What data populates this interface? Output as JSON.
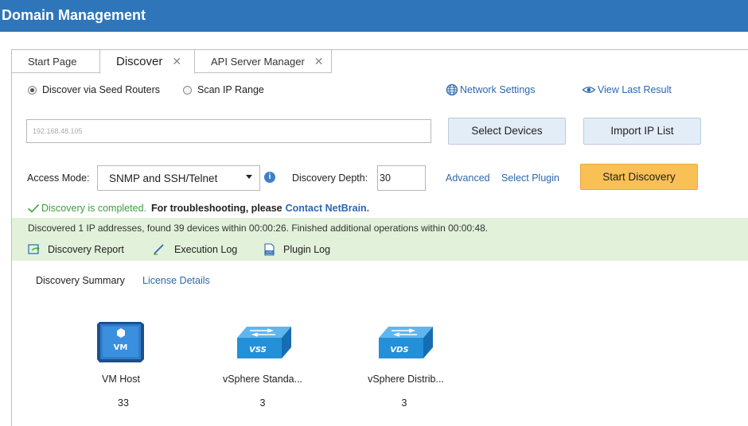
{
  "window": {
    "title": "Domain Management"
  },
  "tabs": [
    {
      "label": "Start Page"
    },
    {
      "label": "Discover"
    },
    {
      "label": "API Server Manager"
    }
  ],
  "discover": {
    "radio_seed_label": "Discover via Seed Routers",
    "radio_scan_label": "Scan IP Range",
    "network_settings_label": "Network Settings",
    "view_last_result_label": "View Last Result",
    "seed_ip_value": "192.168.48.105",
    "select_devices_label": "Select Devices",
    "import_ip_list_label": "Import IP List",
    "access_mode_label": "Access Mode:",
    "access_mode_value": "SNMP and SSH/Telnet",
    "discovery_depth_label": "Discovery Depth:",
    "discovery_depth_value": "30",
    "advanced_label": "Advanced",
    "select_plugin_label": "Select Plugin",
    "start_discovery_label": "Start Discovery"
  },
  "status": {
    "completed_text": "Discovery is completed.",
    "troubleshoot_text": "For troubleshooting, please",
    "contact_link": "Contact NetBrain.",
    "summary_line": "Discovered 1 IP addresses, found 39 devices within 00:00:26.  Finished additional operations within 00:00:48.",
    "discovery_report_label": "Discovery Report",
    "execution_log_label": "Execution Log",
    "plugin_log_label": "Plugin Log"
  },
  "summary": {
    "discovery_summary_label": "Discovery Summary",
    "license_details_label": "License Details",
    "devices": [
      {
        "name": "VM Host",
        "count": "33",
        "icon_text": "VM",
        "icon": "vm-host-icon"
      },
      {
        "name": "vSphere Standa...",
        "count": "3",
        "icon_text": "VSS",
        "icon": "vswitch-icon"
      },
      {
        "name": "vSphere Distrib...",
        "count": "3",
        "icon_text": "VDS",
        "icon": "vswitch-icon"
      }
    ]
  },
  "colors": {
    "header": "#2e76b9",
    "primary_button": "#f9c055",
    "success_bar": "#e1f1da",
    "link": "#2b68b0",
    "success_check": "#3aa13a"
  }
}
